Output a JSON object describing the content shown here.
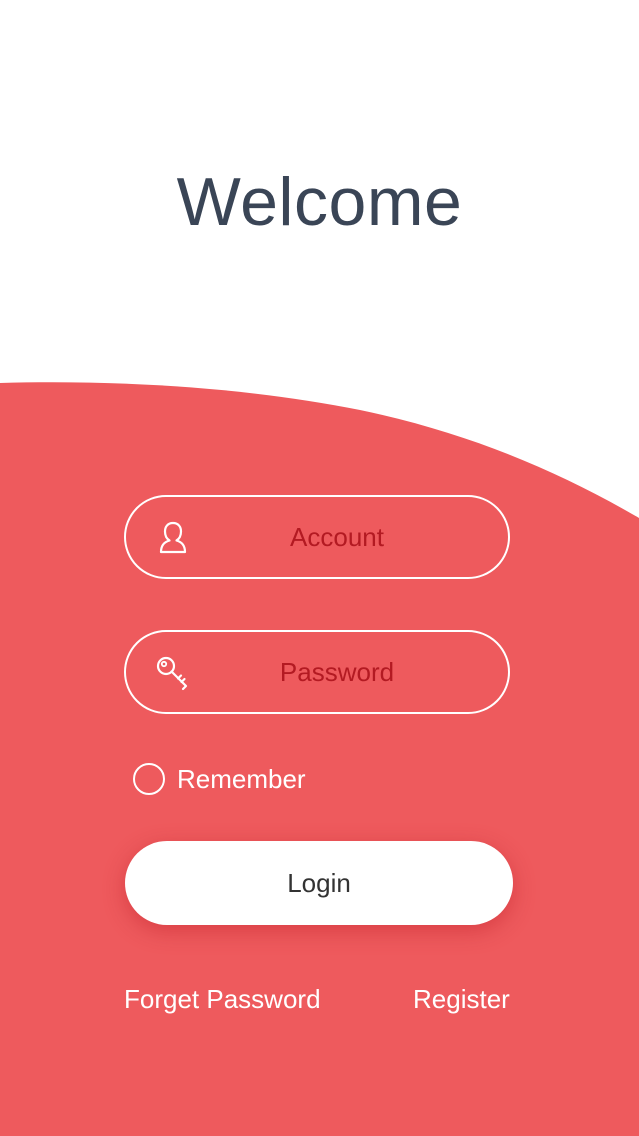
{
  "welcome": {
    "title": "Welcome"
  },
  "form": {
    "account": {
      "placeholder": "Account",
      "icon": "user-icon"
    },
    "password": {
      "placeholder": "Password",
      "icon": "key-icon"
    },
    "remember_label": "Remember",
    "remember_checked": false,
    "login_label": "Login"
  },
  "links": {
    "forget_password": "Forget Password",
    "register": "Register"
  },
  "colors": {
    "accent": "#ee5a5d",
    "title": "#3a4556",
    "placeholder": "#b31a22",
    "background": "#ffffff"
  }
}
